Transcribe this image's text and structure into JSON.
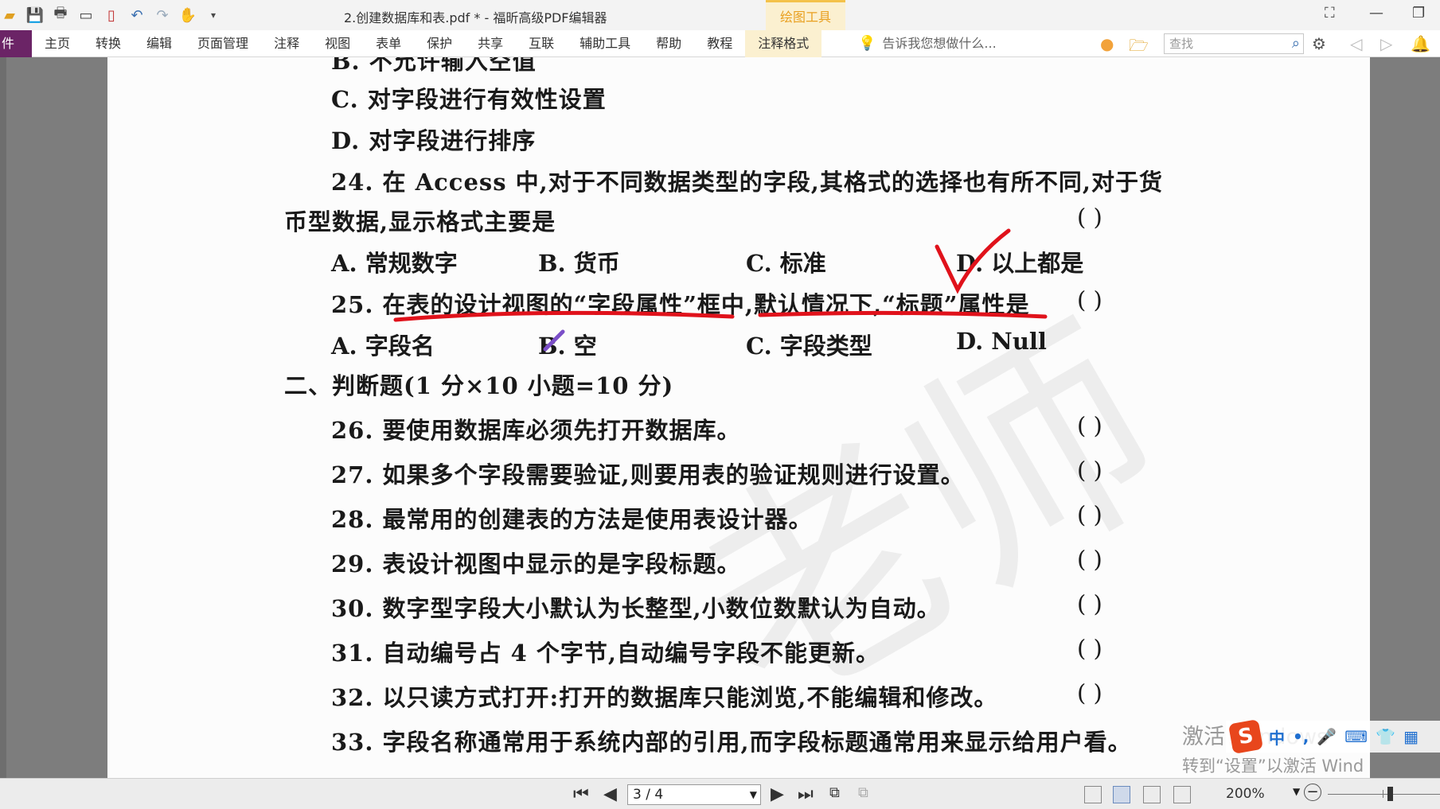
{
  "window": {
    "title": "2.创建数据库和表.pdf * - 福昕高级PDF编辑器",
    "context_tab": "绘图工具"
  },
  "menu": {
    "file_label": "件",
    "items": [
      "主页",
      "转换",
      "编辑",
      "页面管理",
      "注释",
      "视图",
      "表单",
      "保护",
      "共享",
      "互联",
      "辅助工具",
      "帮助",
      "教程",
      "注释格式"
    ],
    "tell_me": "告诉我您想做什么...",
    "search_placeholder": "查找"
  },
  "document": {
    "lines": [
      {
        "text": "B. 不允许输入空值"
      },
      {
        "text": "C. 对字段进行有效性设置"
      },
      {
        "text": "D. 对字段进行排序"
      },
      {
        "text": "24. 在 Access 中,对于不同数据类型的字段,其格式的选择也有所不同,对于货"
      },
      {
        "text": "币型数据,显示格式主要是"
      },
      {
        "text": "25. 在表的设计视图的“字段属性”框中,默认情况下,“标题”属性是"
      },
      {
        "text": "二、判断题(1 分×10 小题=10 分)"
      },
      {
        "text": "26. 要使用数据库必须先打开数据库。"
      },
      {
        "text": "27. 如果多个字段需要验证,则要用表的验证规则进行设置。"
      },
      {
        "text": "28. 最常用的创建表的方法是使用表设计器。"
      },
      {
        "text": "29. 表设计视图中显示的是字段标题。"
      },
      {
        "text": "30. 数字型字段大小默认为长整型,小数位数默认为自动。"
      },
      {
        "text": "31. 自动编号占 4 个字节,自动编号字段不能更新。"
      },
      {
        "text": "32. 以只读方式打开:打开的数据库只能浏览,不能编辑和修改。"
      },
      {
        "text": "33. 字段名称通常用于系统内部的引用,而字段标题通常用来显示给用户看。"
      }
    ],
    "q24_options": [
      "A. 常规数字",
      "B. 货币",
      "C. 标准",
      "D. 以上都是"
    ],
    "q25_options": [
      "A. 字段名",
      "B. 空",
      "C. 字段类型",
      "D. Null"
    ],
    "paren": "(      )",
    "annotation_color": "#e0121b",
    "pen_color": "#7b4fc8"
  },
  "overlay": {
    "win_line1": "激活 Windows",
    "win_line2": "转到“设置”以激活 Wind",
    "ime_logo": "S",
    "ime_lang": "中"
  },
  "statusbar": {
    "page_indicator": "3 / 4",
    "zoom": "200%",
    "zoom_level_fraction": 0.55
  }
}
